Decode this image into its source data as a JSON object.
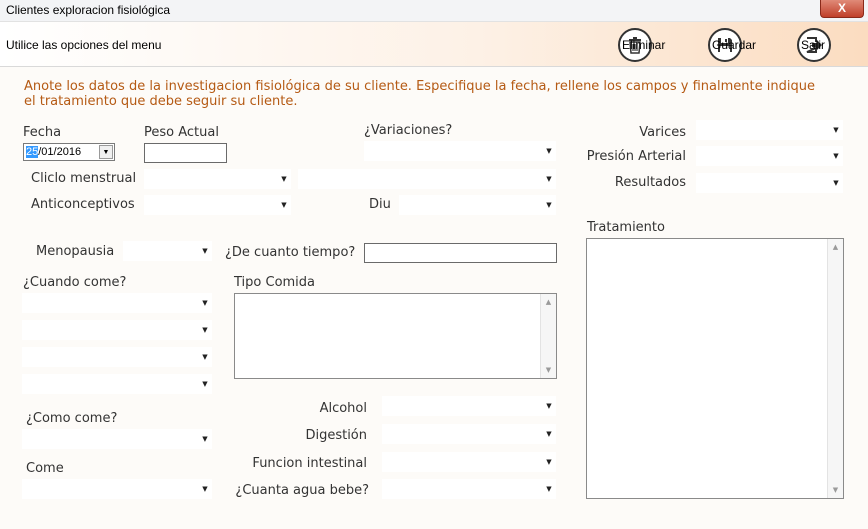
{
  "window": {
    "title": "Clientes exploracion fisiológica",
    "close_label": "X"
  },
  "toolbar": {
    "hint": "Utilice las opciones del menu",
    "delete_label": "Eliminar",
    "save_label": "Guardar",
    "exit_label": "Salir"
  },
  "intro": "Anote los datos de la investigacion fisiológica de su cliente. Especifique la fecha, rellene los campos y finalmente indique el tratamiento que debe seguir su cliente.",
  "form": {
    "fecha_label": "Fecha",
    "fecha_day": "25",
    "fecha_rest": "/01/2016",
    "peso_label": "Peso Actual",
    "variaciones_label": "¿Variaciones?",
    "ciclo_label": "Cliclo menstrual",
    "anticonceptivos_label": "Anticonceptivos",
    "diu_label": "Diu",
    "menopausia_label": "Menopausia",
    "tiempo_label": "¿De cuanto tiempo?",
    "cuando_come_label": "¿Cuando come?",
    "tipo_comida_label": "Tipo Comida",
    "como_come_label": "¿Como come?",
    "come_label": "Come",
    "alcohol_label": "Alcohol",
    "digestion_label": "Digestión",
    "funcion_label": "Funcion intestinal",
    "agua_label": "¿Cuanta agua bebe?",
    "varices_label": "Varices",
    "presion_label": "Presión Arterial",
    "resultados_label": "Resultados",
    "tratamiento_label": "Tratamiento"
  },
  "icons": {
    "delete": "trash-icon",
    "save": "floppy-disk-icon",
    "exit": "exit-door-icon",
    "dropdown": "chevron-down-icon"
  },
  "colors": {
    "intro_text": "#b55a14",
    "toolbar_gradient_end": "#fbdcc0",
    "close_button": "#c0402a",
    "date_selection": "#3399ff"
  }
}
